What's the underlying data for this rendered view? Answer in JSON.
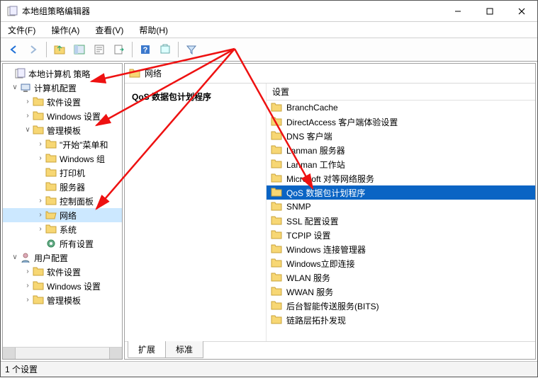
{
  "window": {
    "title": "本地组策略编辑器"
  },
  "menu": {
    "file": "文件(F)",
    "action": "操作(A)",
    "view": "查看(V)",
    "help": "帮助(H)"
  },
  "tree": {
    "root": "本地计算机 策略",
    "computer_cfg": "计算机配置",
    "software_settings": "软件设置",
    "windows_settings": "Windows 设置",
    "admin_templates": "管理模板",
    "start_menu": "\"开始\"菜单和",
    "windows_comp": "Windows 组",
    "printers": "打印机",
    "servers": "服务器",
    "control_panel": "控制面板",
    "network": "网络",
    "system": "系统",
    "all_settings": "所有设置",
    "user_cfg": "用户配置",
    "u_software_settings": "软件设置",
    "u_windows_settings": "Windows 设置",
    "u_admin_templates": "管理模板"
  },
  "crumb": {
    "label": "网络"
  },
  "detail": {
    "heading": "QoS 数据包计划程序",
    "col_header": "设置"
  },
  "list": [
    "BranchCache",
    "DirectAccess 客户端体验设置",
    "DNS 客户端",
    "Lanman 服务器",
    "Lanman 工作站",
    "Microsoft 对等网络服务",
    "QoS 数据包计划程序",
    "SNMP",
    "SSL 配置设置",
    "TCPIP 设置",
    "Windows 连接管理器",
    "Windows立即连接",
    "WLAN 服务",
    "WWAN 服务",
    "后台智能传送服务(BITS)",
    "链路层拓扑发现"
  ],
  "list_selected_index": 6,
  "tabs": {
    "extended": "扩展",
    "standard": "标准"
  },
  "status": {
    "text": "1 个设置"
  }
}
